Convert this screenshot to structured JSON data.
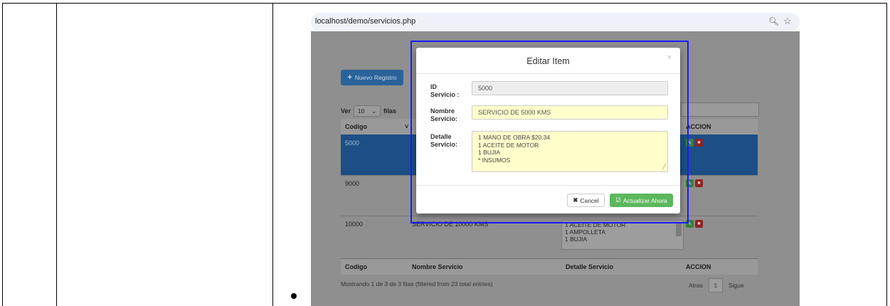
{
  "browser": {
    "url": "localhost/demo/servicios.php",
    "zoom_icon": "magnify-icon",
    "star_icon": "star-icon"
  },
  "page": {
    "new_button_label": "Nuevo Registro",
    "show_prefix": "Ver",
    "show_value": "10",
    "show_suffix": "filas",
    "columns": [
      "Codigo",
      "Nombre Servicio",
      "Detalle Servicio",
      "ACCION"
    ],
    "rows": [
      {
        "code": "5000",
        "name": "",
        "detail": ""
      },
      {
        "code": "9000",
        "name": "",
        "detail": ""
      },
      {
        "code": "10000",
        "name": "SERVICIO DE 10000 KMS",
        "detail": "1 ACEITE DE MOTOR\n1 AMPOLLETA\n1 BUJIA"
      }
    ],
    "info_text": "Mostrando 1 de 3 de 3 filas (filtered from 23 total entries)",
    "pager": {
      "prev": "Atras",
      "current": "1",
      "next": "Sigue"
    }
  },
  "modal": {
    "title": "Editar Item",
    "close": "×",
    "id_label": "ID Servicio :",
    "id_value": "5000",
    "name_label": "Nombre Servicio:",
    "name_value": "SERVICIO DE 5000 KMS",
    "detail_label": "Detalle Servicio:",
    "detail_value": "1 MANO DE OBRA $20.34\n1 ACEITE DE MOTOR\n1 BUJIA\n* INSUMOS",
    "cancel_label": "Cancel",
    "update_label": "Actualizar Ahora"
  }
}
